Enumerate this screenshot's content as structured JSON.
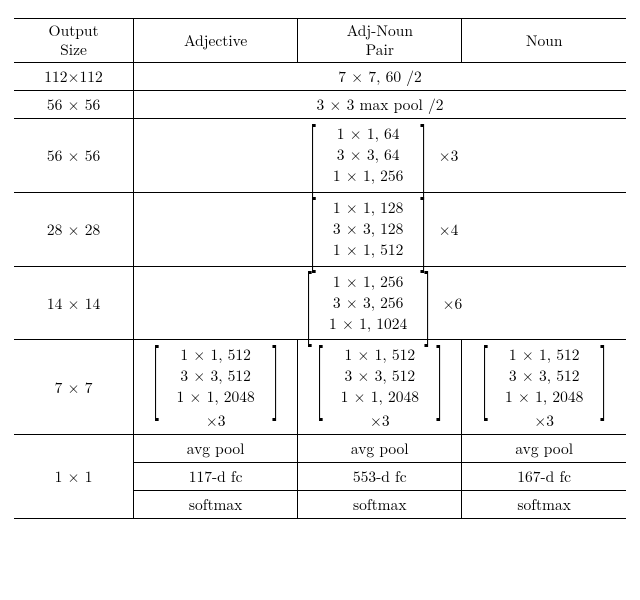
{
  "headers": {
    "output_size_line1": "Output",
    "output_size_line2": "Size",
    "adjective": "Adjective",
    "pair_line1": "Adj-Noun",
    "pair_line2": "Pair",
    "noun": "Noun"
  },
  "row1": {
    "size": "112×112",
    "span": "7 × 7, 60 /2"
  },
  "row2": {
    "size": "56 × 56",
    "span": "3 × 3 max pool /2"
  },
  "row3": {
    "size": "56 × 56",
    "block": {
      "r1": "1 × 1, 64",
      "r2": "3 × 3, 64",
      "r3": "1 × 1, 256"
    },
    "mult": "×3"
  },
  "row4": {
    "size": "28 × 28",
    "block": {
      "r1": "1 × 1, 128",
      "r2": "3 × 3, 128",
      "r3": "1 × 1, 512"
    },
    "mult": "×4"
  },
  "row5": {
    "size": "14 × 14",
    "block": {
      "r1": "1 × 1, 256",
      "r2": "3 × 3, 256",
      "r3": "1 × 1, 1024"
    },
    "mult": "×6"
  },
  "row6": {
    "size": "7 × 7",
    "adj": {
      "r1": "1 × 1, 512",
      "r2": "3 × 3, 512",
      "r3": "1 × 1, 2048",
      "mult": "×3"
    },
    "pair": {
      "r1": "1 × 1, 512",
      "r2": "3 × 3, 512",
      "r3": "1 × 1, 2048",
      "mult": "×3"
    },
    "noun": {
      "r1": "1 × 1, 512",
      "r2": "3 × 3, 512",
      "r3": "1 × 1, 2048",
      "mult": "×3"
    }
  },
  "row7": {
    "size": "1 × 1",
    "adj": "avg pool",
    "pair": "avg pool",
    "noun": "avg pool"
  },
  "row8": {
    "adj": "117-d fc",
    "pair": "553-d fc",
    "noun": "167-d fc"
  },
  "row9": {
    "adj": "softmax",
    "pair": "softmax",
    "noun": "softmax"
  },
  "chart_data": {
    "type": "table",
    "title": "Network architecture (ResNet-style) with three heads: Adjective, Adj-Noun Pair, Noun",
    "columns": [
      "Output Size",
      "Adjective",
      "Adj-Noun Pair",
      "Noun"
    ],
    "rows": [
      {
        "output_size": "112×112",
        "shared": "7×7, 60, stride 2"
      },
      {
        "output_size": "56×56",
        "shared": "3×3 max pool, stride 2"
      },
      {
        "output_size": "56×56",
        "shared_block": {
          "bottleneck": [
            "1×1,64",
            "3×3,64",
            "1×1,256"
          ],
          "repeats": 3
        }
      },
      {
        "output_size": "28×28",
        "shared_block": {
          "bottleneck": [
            "1×1,128",
            "3×3,128",
            "1×1,512"
          ],
          "repeats": 4
        }
      },
      {
        "output_size": "14×14",
        "shared_block": {
          "bottleneck": [
            "1×1,256",
            "3×3,256",
            "1×1,1024"
          ],
          "repeats": 6
        }
      },
      {
        "output_size": "7×7",
        "Adjective": {
          "bottleneck": [
            "1×1,512",
            "3×3,512",
            "1×1,2048"
          ],
          "repeats": 3
        },
        "Adj-Noun Pair": {
          "bottleneck": [
            "1×1,512",
            "3×3,512",
            "1×1,2048"
          ],
          "repeats": 3
        },
        "Noun": {
          "bottleneck": [
            "1×1,512",
            "3×3,512",
            "1×1,2048"
          ],
          "repeats": 3
        }
      },
      {
        "output_size": "1×1",
        "Adjective": [
          "avg pool",
          "117-d fc",
          "softmax"
        ],
        "Adj-Noun Pair": [
          "avg pool",
          "553-d fc",
          "softmax"
        ],
        "Noun": [
          "avg pool",
          "167-d fc",
          "softmax"
        ]
      }
    ]
  }
}
